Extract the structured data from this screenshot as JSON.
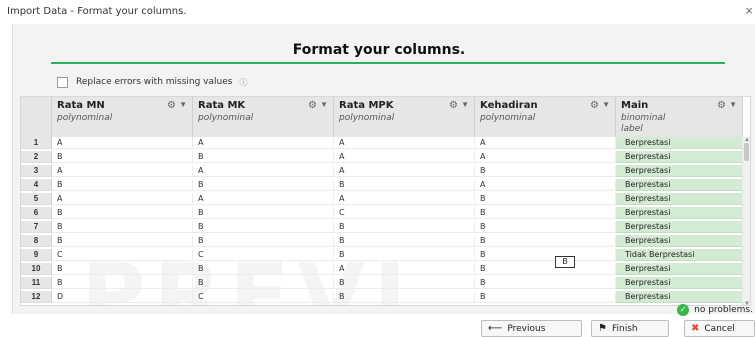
{
  "window": {
    "title": "Import Data - Format your columns.",
    "close_glyph": "×"
  },
  "heading": "Format your columns.",
  "options": {
    "replace_errors_label": "Replace errors with missing values",
    "replace_errors_checked": false
  },
  "columns": [
    {
      "name": "Rata MN",
      "type": "polynominal",
      "role": ""
    },
    {
      "name": "Rata MK",
      "type": "polynominal",
      "role": ""
    },
    {
      "name": "Rata MPK",
      "type": "polynominal",
      "role": ""
    },
    {
      "name": "Kehadiran",
      "type": "polynominal",
      "role": ""
    },
    {
      "name": "Main",
      "type": "binominal",
      "role": "label"
    }
  ],
  "rows": [
    [
      "1",
      "A",
      "A",
      "A",
      "A",
      "Berprestasi"
    ],
    [
      "2",
      "B",
      "B",
      "A",
      "A",
      "Berprestasi"
    ],
    [
      "3",
      "A",
      "A",
      "A",
      "B",
      "Berprestasi"
    ],
    [
      "4",
      "B",
      "B",
      "B",
      "A",
      "Berprestasi"
    ],
    [
      "5",
      "A",
      "A",
      "A",
      "B",
      "Berprestasi"
    ],
    [
      "6",
      "B",
      "B",
      "C",
      "B",
      "Berprestasi"
    ],
    [
      "7",
      "B",
      "B",
      "B",
      "B",
      "Berprestasi"
    ],
    [
      "8",
      "B",
      "B",
      "B",
      "B",
      "Berprestasi"
    ],
    [
      "9",
      "C",
      "C",
      "B",
      "B",
      "Tidak Berprestasi"
    ],
    [
      "10",
      "B",
      "B",
      "A",
      "B",
      "Berprestasi"
    ],
    [
      "11",
      "B",
      "B",
      "B",
      "B",
      "Berprestasi"
    ],
    [
      "12",
      "D",
      "C",
      "B",
      "B",
      "Berprestasi"
    ]
  ],
  "tooltip_value": "B",
  "watermark": "PREVI",
  "status": {
    "text": "no problems."
  },
  "buttons": {
    "previous": "Previous",
    "finish": "Finish",
    "cancel": "Cancel"
  },
  "colors": {
    "accent_line": "#27b35e",
    "label_column": "#d3ebd3",
    "status_ok": "#39b54a",
    "cancel_icon": "#e8442e"
  },
  "icons": {
    "column_menu": "gear-icon",
    "status": "check-circle-icon",
    "previous": "arrow-left-icon",
    "finish": "checkered-flag-icon",
    "cancel": "red-x-icon"
  }
}
